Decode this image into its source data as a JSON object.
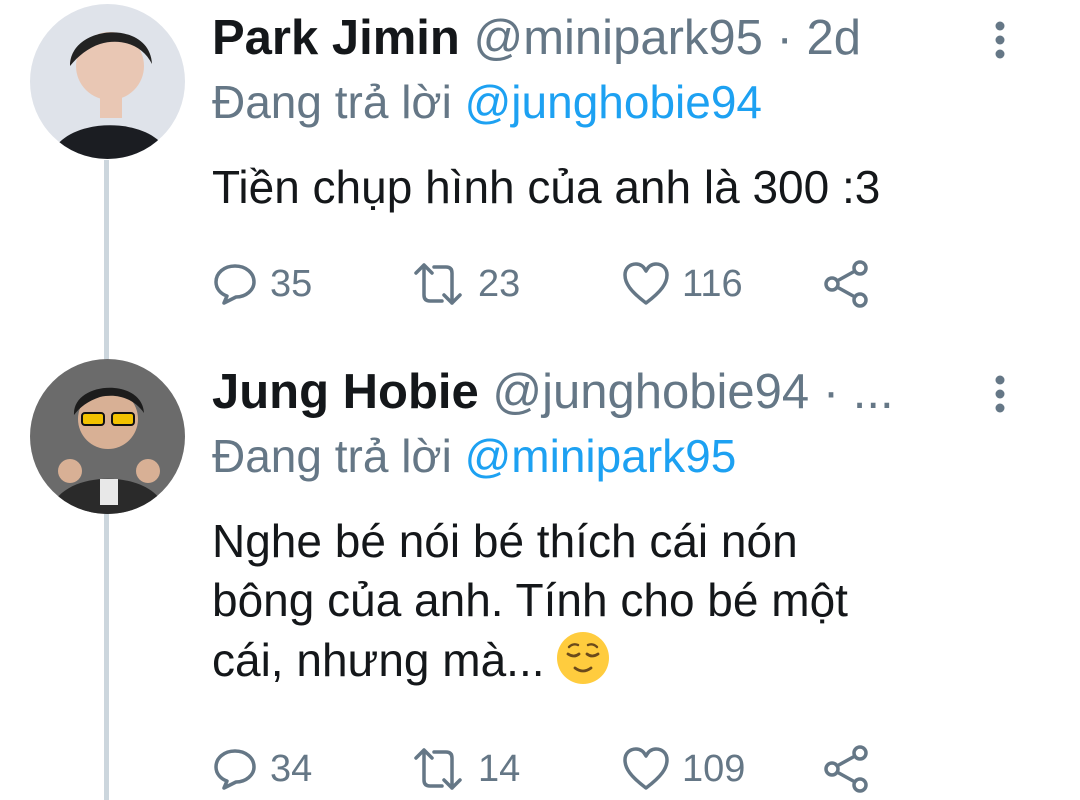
{
  "tweets": [
    {
      "display_name": "Park Jimin",
      "handle": "@minipark95",
      "separator": "·",
      "time": "2d",
      "reply_prefix": "Đang trả lời",
      "reply_to": "@junghobie94",
      "text": "Tiền chụp hình của anh là 300 :3",
      "replies": "35",
      "retweets": "23",
      "likes": "116"
    },
    {
      "display_name": "Jung Hobie",
      "handle": "@junghobie94",
      "separator": "·",
      "time": "...",
      "reply_prefix": "Đang trả lời",
      "reply_to": "@minipark95",
      "text_lines": [
        "Nghe bé nói bé thích cái nón",
        "bông của anh. Tính cho bé một",
        "cái, nhưng mà..."
      ],
      "emoji": "relieved-face",
      "replies": "34",
      "retweets": "14",
      "likes": "109"
    }
  ],
  "colors": {
    "text": "#14171a",
    "secondary": "#657786",
    "link": "#1da1f2",
    "thread_line": "#ccd6dd"
  }
}
